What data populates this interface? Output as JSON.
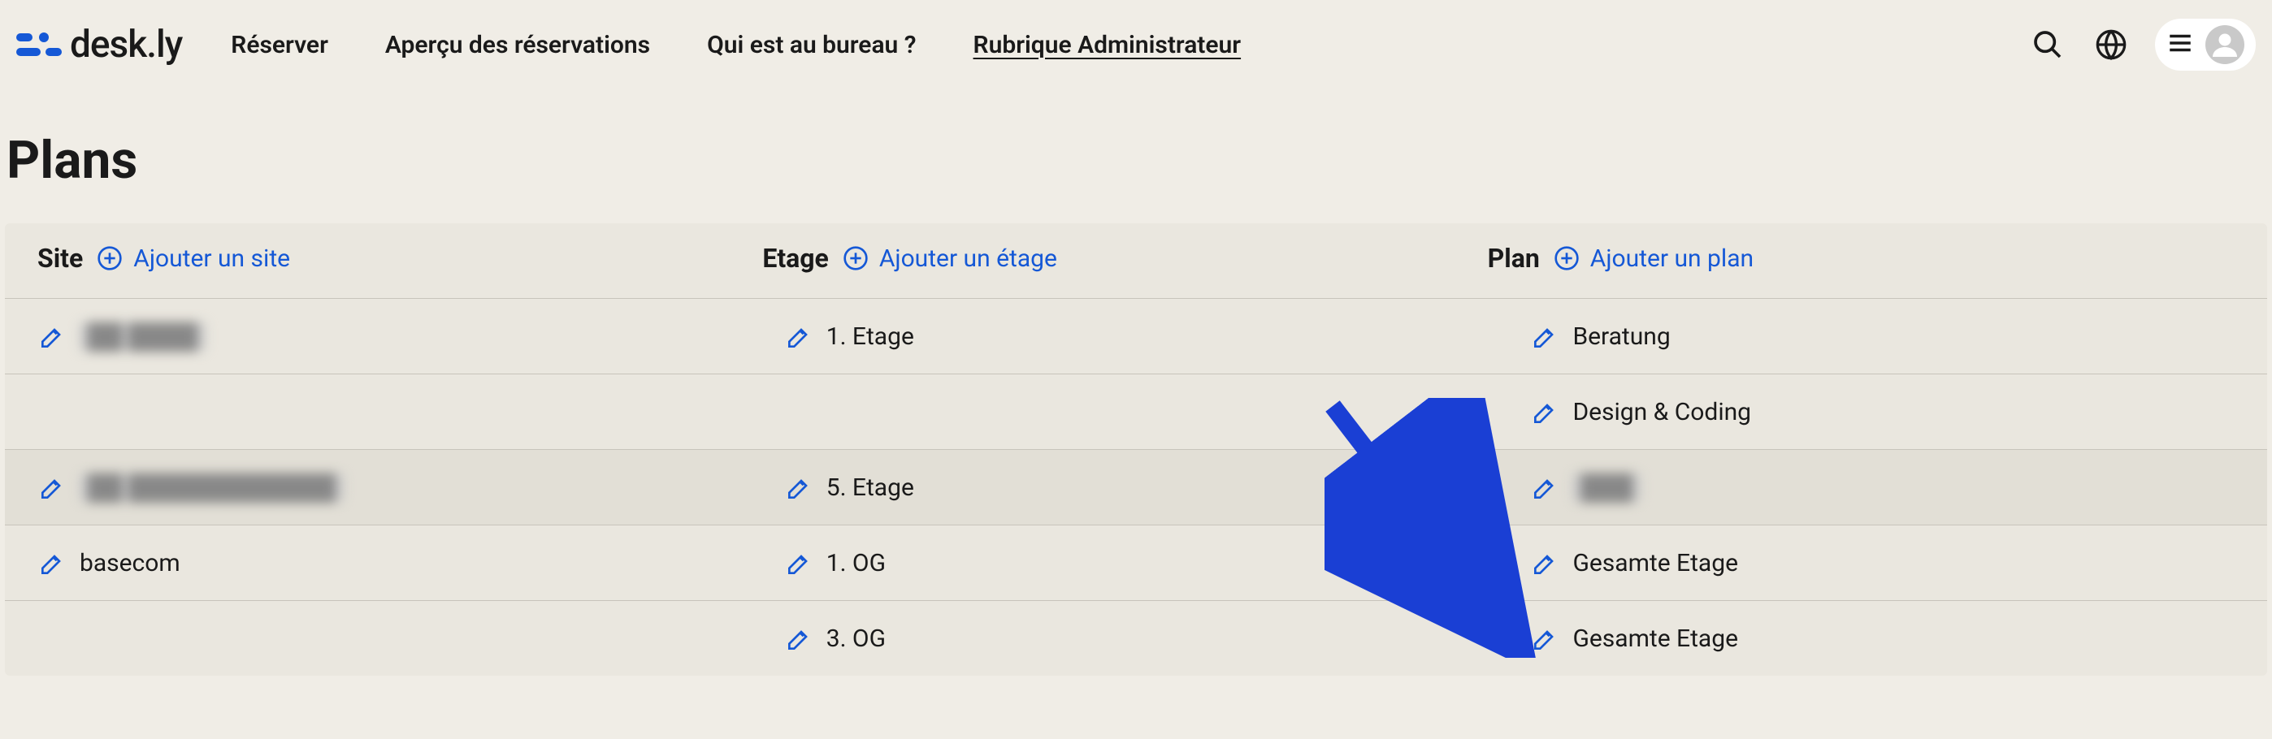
{
  "brand": {
    "name": "desk.ly"
  },
  "nav": {
    "items": [
      {
        "label": "Réserver",
        "active": false
      },
      {
        "label": "Aperçu des réservations",
        "active": false
      },
      {
        "label": "Qui est au bureau ?",
        "active": false
      },
      {
        "label": "Rubrique Administrateur",
        "active": true
      }
    ]
  },
  "page": {
    "title": "Plans"
  },
  "columns": {
    "site": {
      "label": "Site",
      "add_label": "Ajouter un site"
    },
    "etage": {
      "label": "Etage",
      "add_label": "Ajouter un étage"
    },
    "plan": {
      "label": "Plan",
      "add_label": "Ajouter un plan"
    }
  },
  "rows": [
    {
      "alt": false,
      "site": {
        "text": "██ ████",
        "blurred": true
      },
      "etage": {
        "text": "1. Etage",
        "blurred": false
      },
      "plan": {
        "text": "Beratung",
        "blurred": false
      }
    },
    {
      "alt": false,
      "site": null,
      "etage": null,
      "plan": {
        "text": "Design & Coding",
        "blurred": false
      }
    },
    {
      "alt": true,
      "site": {
        "text": "██ ████████████",
        "blurred": true
      },
      "etage": {
        "text": "5. Etage",
        "blurred": false
      },
      "plan": {
        "text": "███",
        "blurred": true
      }
    },
    {
      "alt": false,
      "site": {
        "text": "basecom",
        "blurred": false
      },
      "etage": {
        "text": "1. OG",
        "blurred": false
      },
      "plan": {
        "text": "Gesamte Etage",
        "blurred": false
      }
    },
    {
      "alt": false,
      "site": null,
      "etage": {
        "text": "3. OG",
        "blurred": false
      },
      "plan": {
        "text": "Gesamte Etage",
        "blurred": false
      }
    }
  ],
  "colors": {
    "link": "#1558d6",
    "arrow": "#1a3fd4"
  }
}
